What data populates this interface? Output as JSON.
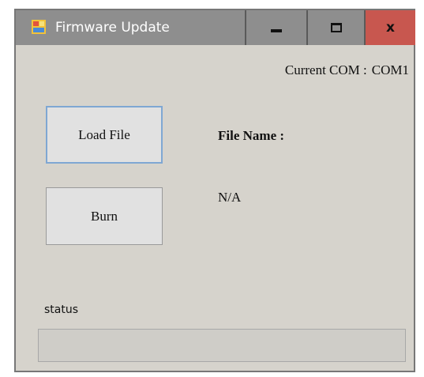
{
  "window": {
    "title": "Firmware Update",
    "controls": {
      "minimize_icon": "minimize-icon",
      "maximize_icon": "maximize-icon",
      "close_label": "x",
      "close_color": "#c8574f"
    }
  },
  "com": {
    "label": "Current COM :",
    "value": "COM1"
  },
  "buttons": {
    "load_label": "Load File",
    "burn_label": "Burn"
  },
  "file": {
    "label": "File Name :",
    "value": "N/A"
  },
  "status": {
    "label": "status",
    "progress": 0
  }
}
